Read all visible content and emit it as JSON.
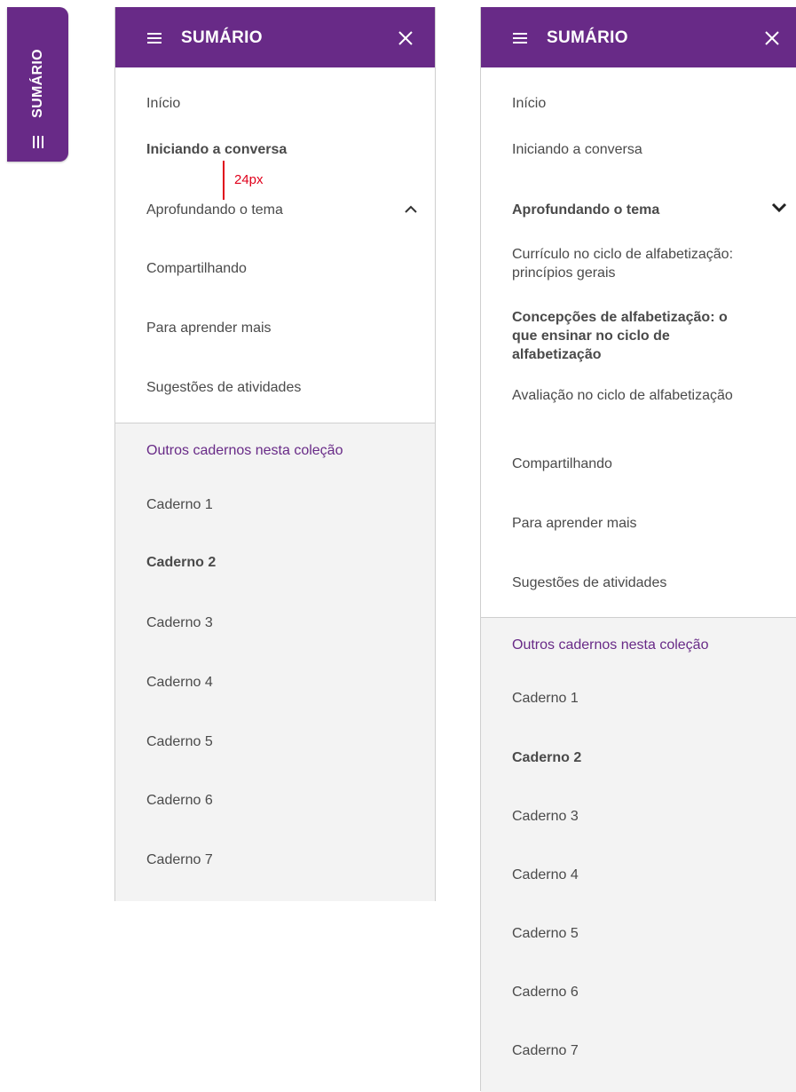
{
  "side_tab": {
    "label": "SUMÁRIO",
    "icon": "menu-lines-icon"
  },
  "colors": {
    "brand_purple": "#682a87",
    "text": "#4a4a4a",
    "gray_bg": "#f3f3f3",
    "border": "#cfcfcf",
    "spec_red": "#e0001b"
  },
  "panel_left": {
    "title": "SUMÁRIO",
    "menu_icon": "hamburger-icon",
    "close_icon": "close-icon",
    "items": [
      {
        "label": "Início"
      },
      {
        "label": "Iniciando a conversa"
      },
      {
        "label": "Aprofundando o tema"
      },
      {
        "label": "Compartilhando"
      },
      {
        "label": "Para aprender mais"
      },
      {
        "label": "Sugestões de atividades"
      }
    ],
    "expand_icon": "chevron-up-icon",
    "spacing_annotation": "24px",
    "other_title": "Outros cadernos nesta coleção",
    "cadernos": [
      "Caderno 1",
      "Caderno 2",
      "Caderno 3",
      "Caderno 4",
      "Caderno 5",
      "Caderno 6",
      "Caderno 7"
    ]
  },
  "panel_right": {
    "title": "SUMÁRIO",
    "menu_icon": "hamburger-icon",
    "close_icon": "close-icon",
    "items": [
      {
        "label": "Início"
      },
      {
        "label": "Iniciando a conversa"
      },
      {
        "label": "Aprofundando o tema"
      },
      {
        "label": "Currículo no ciclo de alfabetização: princípios gerais"
      },
      {
        "label": "Concepções de alfabetização: o que ensinar no ciclo de alfabetização"
      },
      {
        "label": "Avaliação no ciclo de alfabetização"
      },
      {
        "label": "Compartilhando"
      },
      {
        "label": "Para aprender mais"
      },
      {
        "label": "Sugestões de atividades"
      }
    ],
    "expand_icon": "chevron-down-icon",
    "other_title": "Outros cadernos nesta coleção",
    "cadernos": [
      "Caderno 1",
      "Caderno 2",
      "Caderno 3",
      "Caderno 4",
      "Caderno 5",
      "Caderno 6",
      "Caderno 7"
    ]
  }
}
